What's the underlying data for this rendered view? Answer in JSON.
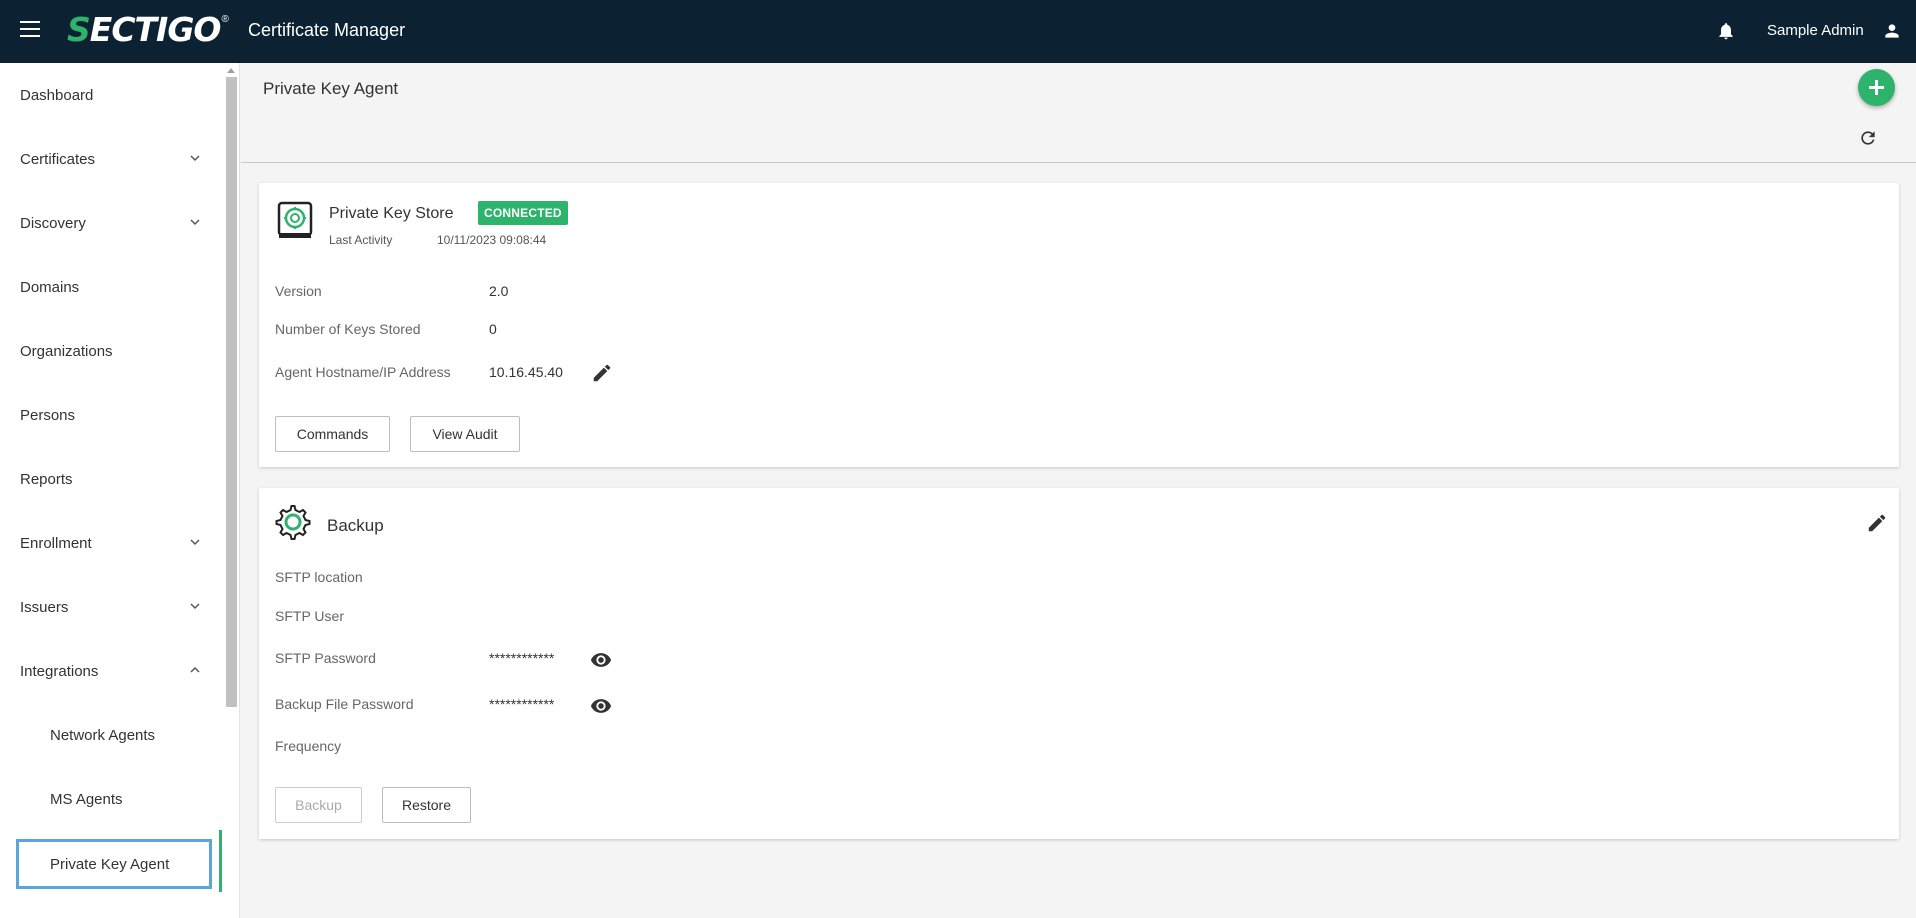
{
  "header": {
    "logo": "SECTIGO",
    "logo_mark": "®",
    "app_title": "Certificate Manager",
    "user_name": "Sample Admin",
    "icons": [
      "menu-icon",
      "bell-icon",
      "user-icon"
    ]
  },
  "sidebar": {
    "items": [
      {
        "label": "Dashboard"
      },
      {
        "label": "Certificates",
        "expandable": true
      },
      {
        "label": "Discovery",
        "expandable": true
      },
      {
        "label": "Domains"
      },
      {
        "label": "Organizations"
      },
      {
        "label": "Persons"
      },
      {
        "label": "Reports"
      },
      {
        "label": "Enrollment",
        "expandable": true
      },
      {
        "label": "Issuers",
        "expandable": true
      },
      {
        "label": "Integrations",
        "expandable": true,
        "expanded": true
      }
    ],
    "sub_items": [
      {
        "label": "Network Agents"
      },
      {
        "label": "MS Agents"
      },
      {
        "label": "Private Key Agent",
        "selected": true
      }
    ]
  },
  "page": {
    "title": "Private Key Agent"
  },
  "store_card": {
    "title": "Private Key Store",
    "status": "CONNECTED",
    "last_activity_label": "Last Activity",
    "last_activity_value": "10/11/2023 09:08:44",
    "fields": [
      {
        "label": "Version",
        "value": "2.0"
      },
      {
        "label": "Number of Keys Stored",
        "value": "0"
      },
      {
        "label": "Agent Hostname/IP Address",
        "value": "10.16.45.40"
      }
    ],
    "buttons": {
      "commands": "Commands",
      "view_audit": "View Audit"
    }
  },
  "backup_card": {
    "title": "Backup",
    "fields": [
      {
        "label": "SFTP location",
        "value": ""
      },
      {
        "label": "SFTP User",
        "value": ""
      },
      {
        "label": "SFTP Password",
        "value": "************"
      },
      {
        "label": "Backup File Password",
        "value": "************"
      },
      {
        "label": "Frequency",
        "value": ""
      }
    ],
    "buttons": {
      "backup": "Backup",
      "restore": "Restore"
    }
  },
  "colors": {
    "topbar": "#0c2233",
    "brand_green": "#2db36b",
    "selection_outline": "#5aa6d8"
  }
}
